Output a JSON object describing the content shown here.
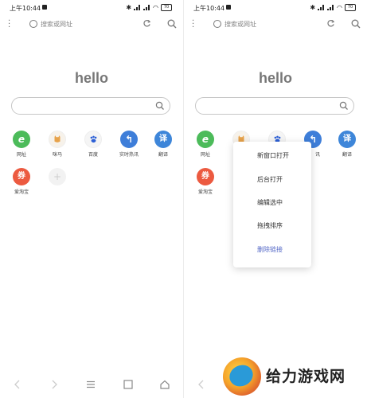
{
  "status": {
    "time": "上午10:44",
    "battery": "70"
  },
  "toolbar": {
    "url_placeholder": "搜索或网址"
  },
  "home": {
    "title": "hello"
  },
  "shortcuts": [
    {
      "label": "网址",
      "glyph": "e",
      "color": "#4cbb5a"
    },
    {
      "label": "咪马",
      "glyph": "",
      "color": "#f5f5f5"
    },
    {
      "label": "百度",
      "glyph": "",
      "color": "#f5f5f5"
    },
    {
      "label": "实时热讯",
      "glyph": "↰",
      "color": "#3e7ed9"
    },
    {
      "label": "翻译",
      "glyph": "译",
      "color": "#3e86d9"
    },
    {
      "label": "爱淘宝",
      "glyph": "券",
      "color": "#ec5a40"
    },
    {
      "label": "",
      "glyph": "+",
      "color": "#f2f2f2"
    }
  ],
  "right_shortcut_labels": [
    "网址",
    "",
    "",
    "讯",
    "翻译",
    "爱淘宝"
  ],
  "context_menu": {
    "items": [
      "新窗口打开",
      "后台打开",
      "编辑选中",
      "拖拽排序",
      "删除链接"
    ]
  },
  "watermark": {
    "text": "给力游戏网"
  }
}
